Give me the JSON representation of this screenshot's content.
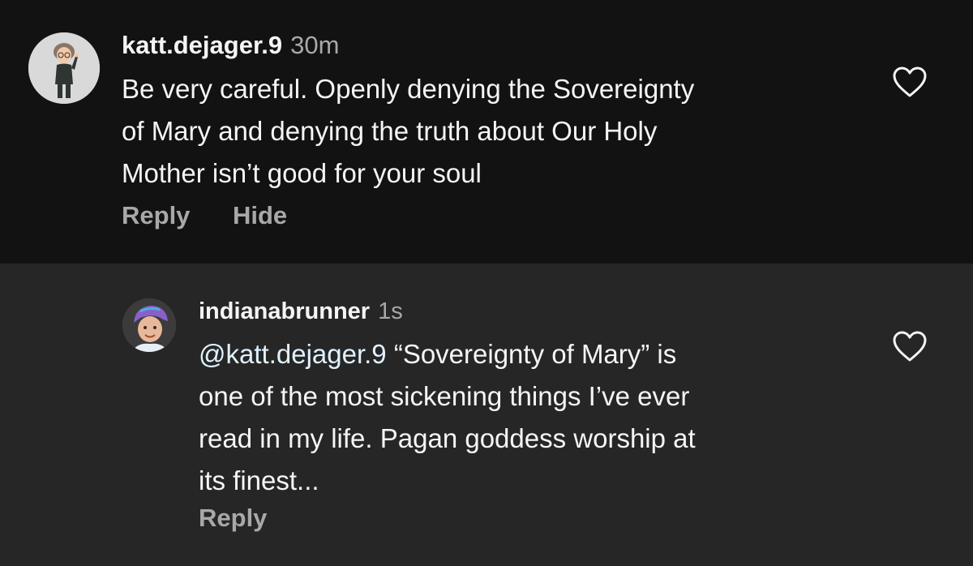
{
  "comments": [
    {
      "username": "katt.dejager.9",
      "time": "30m",
      "lines": [
        "Be very careful. Openly denying the Sovereignty",
        "of Mary and denying the truth about Our Holy",
        "Mother isn’t good for your soul"
      ],
      "actions": {
        "reply": "Reply",
        "hide": "Hide"
      },
      "like_icon": "heart-outline-icon",
      "avatar_icon": "memoji-avatar"
    },
    {
      "username": "indianabrunner",
      "time": "1s",
      "mention": "@katt.dejager.9",
      "lines": [
        " “Sovereignty of Mary” is",
        "one of the most sickening things I’ve ever",
        "read in my life. Pagan goddess worship at",
        "its finest..."
      ],
      "actions": {
        "reply": "Reply"
      },
      "like_icon": "heart-outline-icon",
      "avatar_icon": "child-photo-avatar"
    }
  ],
  "colors": {
    "background_top": "#121212",
    "background_reply": "#262626",
    "primary_text": "#f5f5f5",
    "secondary_text": "#a8a8a8",
    "mention": "#e0f1ff"
  }
}
